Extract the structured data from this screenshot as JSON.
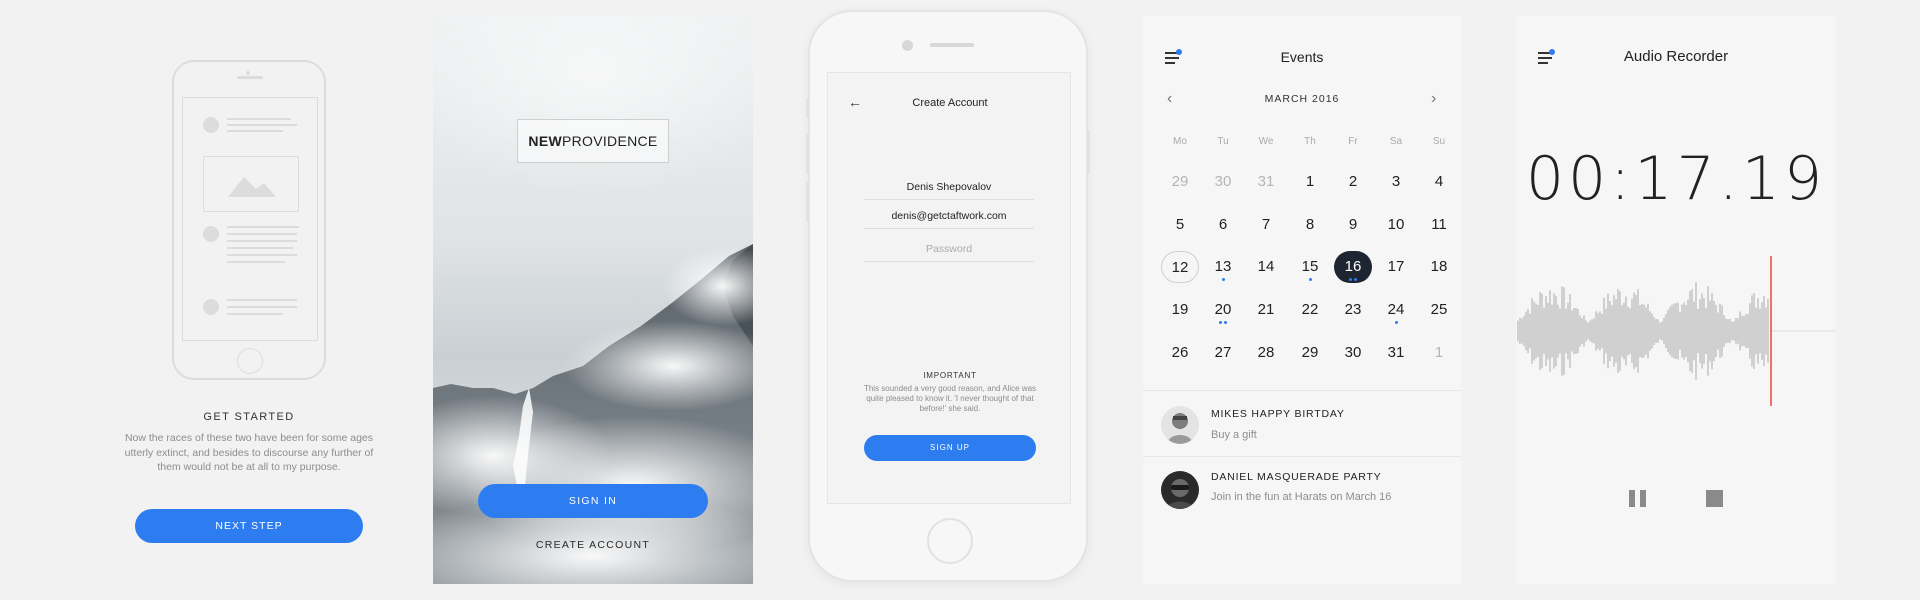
{
  "get_started": {
    "title": "GET STARTED",
    "text": "Now the races of these two have been for some ages utterly extinct, and besides to discourse any further of them would not be at all to my purpose.",
    "button": "NEXT STEP"
  },
  "landing": {
    "logo_bold": "NEW",
    "logo_light": "PROVIDENCE",
    "signin": "SIGN IN",
    "create": "CREATE ACCOUNT"
  },
  "create_account": {
    "title": "Create Account",
    "name_value": "Denis Shepovalov",
    "email_value": "denis@getctaftwork.com",
    "password_placeholder": "Password",
    "important_title": "IMPORTANT",
    "important_text": "This sounded a very good reason, and Alice was quite pleased to know it. 'I never thought of that before!' she said.",
    "signup": "SIGN UP"
  },
  "events": {
    "title": "Events",
    "month": "MARCH 2016",
    "weekdays": [
      "Mo",
      "Tu",
      "We",
      "Th",
      "Fr",
      "Sa",
      "Su"
    ],
    "weeks": [
      [
        "29",
        "30",
        "31",
        "1",
        "2",
        "3",
        "4"
      ],
      [
        "5",
        "6",
        "7",
        "8",
        "9",
        "10",
        "11"
      ],
      [
        "12",
        "13",
        "14",
        "15",
        "16",
        "17",
        "18"
      ],
      [
        "19",
        "20",
        "21",
        "22",
        "23",
        "24",
        "25"
      ],
      [
        "26",
        "27",
        "28",
        "29",
        "30",
        "31",
        "1"
      ]
    ],
    "today": "12",
    "selected": "16",
    "items": [
      {
        "name": "MIKES HAPPY BIRTDAY",
        "sub": "Buy a gift"
      },
      {
        "name": "DANIEL MASQUERADE PARTY",
        "sub": "Join in the fun at Harats on March 16"
      }
    ]
  },
  "recorder": {
    "title": "Audio Recorder",
    "time": "00:17.19"
  },
  "colors": {
    "accent": "#2d7df0",
    "selected_day": "#1c2530",
    "playhead": "#e8473c"
  }
}
